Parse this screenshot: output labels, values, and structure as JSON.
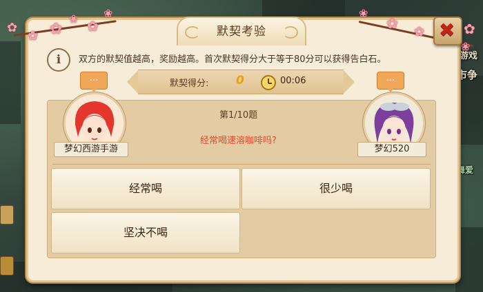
{
  "dialog": {
    "title": "默契考验",
    "info_text": "双方的默契值越高，奖励越高。首次默契得分大于等于80分可以获得告白石。",
    "score_label": "默契得分:",
    "score_value": "0",
    "timer": "00:06",
    "question_number": "第1/10题",
    "question": "经常喝速溶咖啡吗?",
    "options": [
      "经常喝",
      "很少喝",
      "坚决不喝"
    ]
  },
  "players": {
    "left": {
      "name": "梦幻西游手游",
      "bubble": "..."
    },
    "right": {
      "name": "梦幻520",
      "bubble": "..."
    }
  },
  "background": {
    "right_texts": [
      "游戏",
      "市争",
      "舞爱"
    ]
  }
}
